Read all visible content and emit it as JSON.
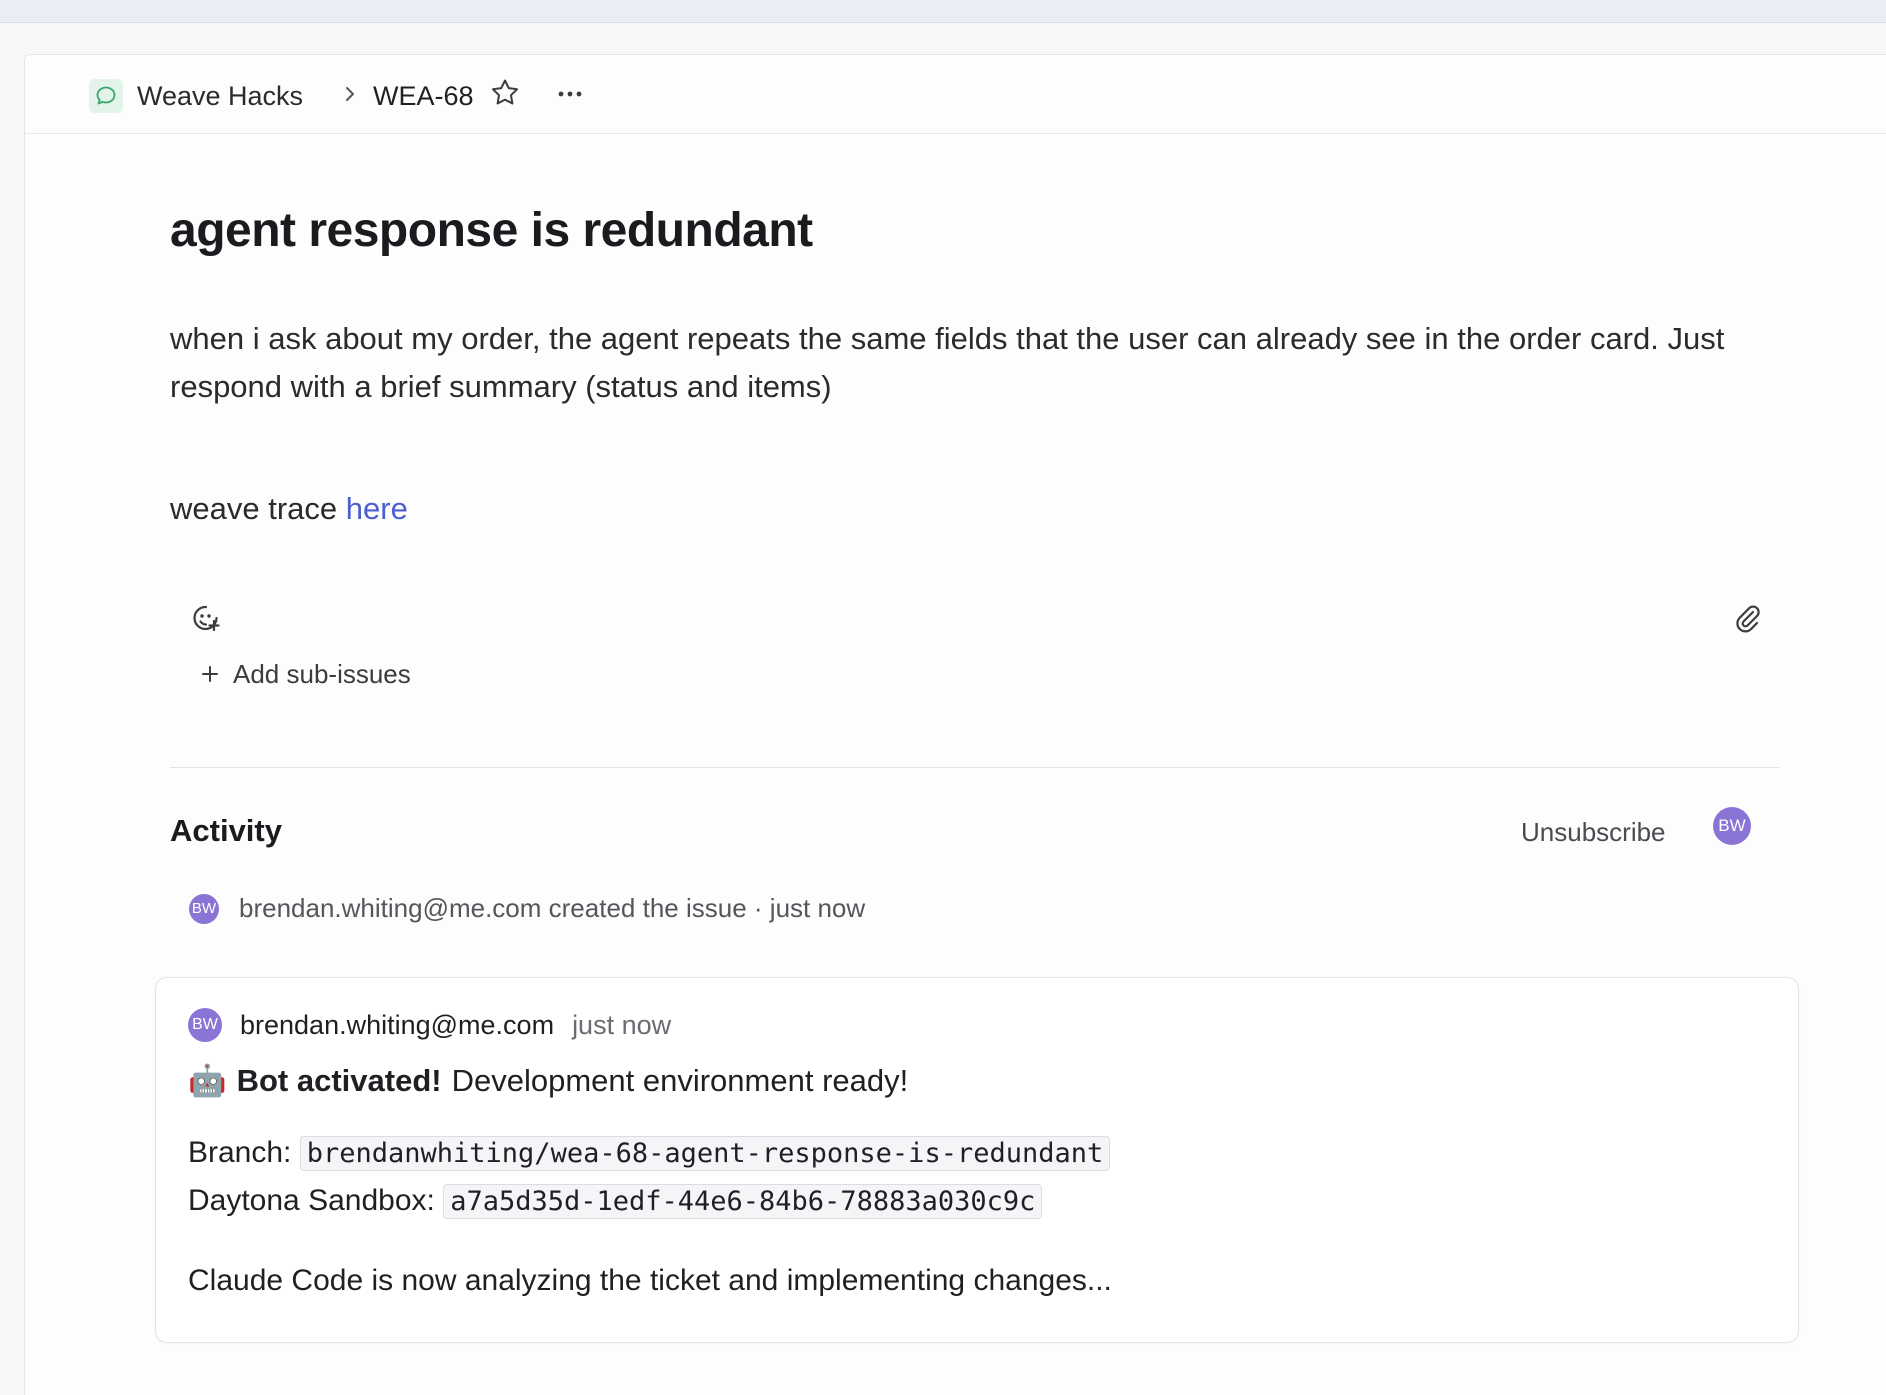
{
  "breadcrumb": {
    "team": "Weave Hacks",
    "issue_id": "WEA-68"
  },
  "issue": {
    "title": "agent response is redundant",
    "description": "when i ask about my order, the agent repeats the same fields that the user can already see in the order card. Just respond with a brief summary (status and items)",
    "trace_prefix": "weave trace",
    "trace_link": "here",
    "add_sub_issues": "Add sub-issues"
  },
  "activity": {
    "title": "Activity",
    "unsubscribe": "Unsubscribe",
    "avatar_initials": "BW",
    "event": {
      "avatar_initials": "BW",
      "text": "brendan.whiting@me.com created the issue",
      "time": "· just now"
    },
    "comment": {
      "avatar_initials": "BW",
      "author": "brendan.whiting@me.com",
      "time": "just now",
      "bot_emoji": "🤖",
      "bot_bold": "Bot activated!",
      "bot_rest": "Development environment ready!",
      "branch_label": "Branch:",
      "branch_value": "brendanwhiting/wea-68-agent-response-is-redundant",
      "sandbox_label": "Daytona Sandbox:",
      "sandbox_value": "a7a5d35d-1edf-44e6-84b6-78883a030c9c",
      "status": "Claude Code is now analyzing the ticket and implementing changes..."
    }
  },
  "icons": {
    "team": "chat-bubble-icon",
    "breadcrumb_separator": "chevron-right-icon",
    "favorite": "star-icon",
    "more": "ellipsis-icon",
    "emoji": "emoji-add-icon",
    "attach": "paperclip-icon",
    "add": "plus-icon"
  },
  "colors": {
    "link": "#4b5fcf",
    "avatar": "#8a74d6",
    "team_icon_bg": "#e2f3ea",
    "team_icon_stroke": "#3aa56f"
  }
}
